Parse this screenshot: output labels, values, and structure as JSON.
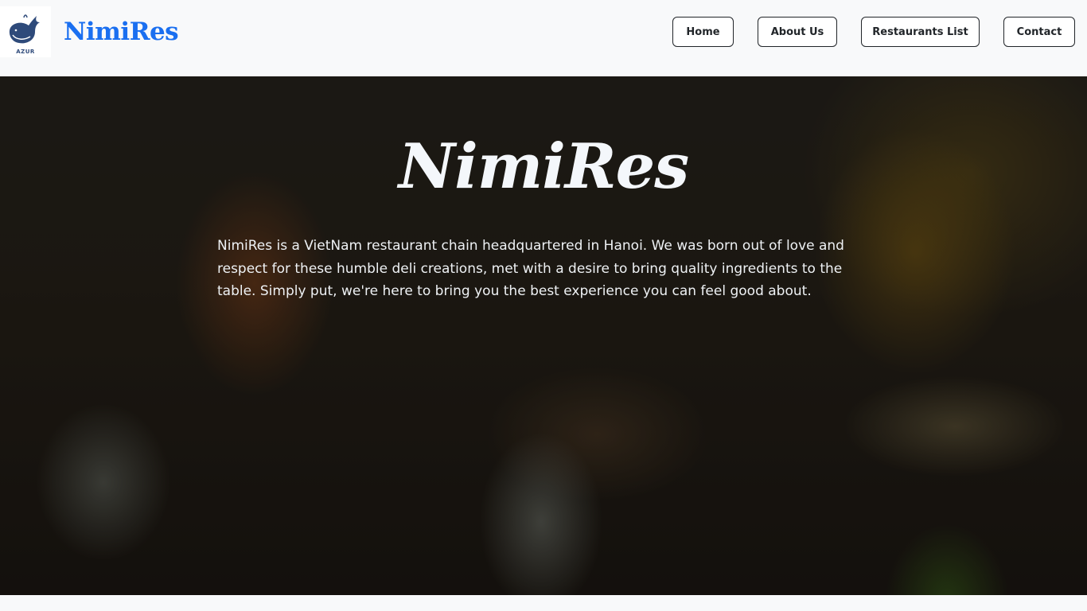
{
  "header": {
    "logo_caption": "AZUR",
    "brand": "NimiRes",
    "nav": {
      "home": "Home",
      "about": "About Us",
      "restaurants": "Restaurants List",
      "contact": "Contact"
    }
  },
  "hero": {
    "title": "NimiRes",
    "description": "NimiRes is a VietNam restaurant chain headquartered in Hanoi. We was born out of love and respect for these humble deli creations, met with a desire to bring quality ingredients to the table. Simply put, we're here to bring you the best experience you can feel good about."
  },
  "colors": {
    "brand": "#1a6ff0",
    "nav_border": "#212529",
    "hero_text": "#eef1f4"
  },
  "icons": {
    "logo": "whale-icon"
  }
}
